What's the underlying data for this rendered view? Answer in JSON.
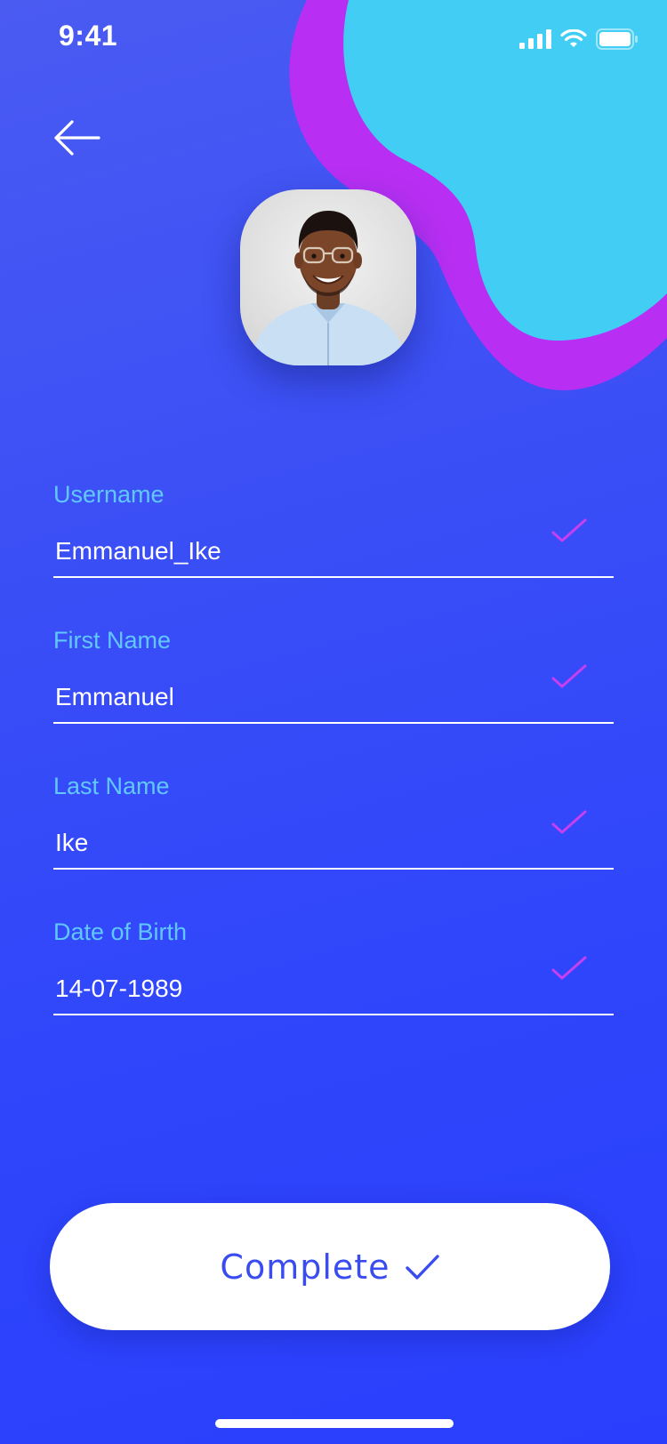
{
  "status_bar": {
    "time": "9:41",
    "signal_icon": "cellular-signal-icon",
    "wifi_icon": "wifi-icon",
    "battery_icon": "battery-icon"
  },
  "header": {
    "back_icon": "arrow-left-icon"
  },
  "avatar": {
    "icon": "profile-photo"
  },
  "form": {
    "fields": [
      {
        "label": "Username",
        "value": "Emmanuel_Ike",
        "status_icon": "checkmark-icon"
      },
      {
        "label": "First Name",
        "value": "Emmanuel",
        "status_icon": "checkmark-icon"
      },
      {
        "label": "Last Name",
        "value": "Ike",
        "status_icon": "checkmark-icon"
      },
      {
        "label": "Date of Birth",
        "value": "14-07-1989",
        "status_icon": "checkmark-icon"
      }
    ]
  },
  "complete_button": {
    "label": "Complete",
    "icon": "checkmark-icon"
  },
  "colors": {
    "background_top": "#4a5bf2",
    "background_bottom": "#2a3ffd",
    "blob_purple": "#b82ff3",
    "blob_cyan": "#41cdf4",
    "label": "#61c8ff",
    "check": "#c63ff0",
    "button_text": "#3a4cf0"
  }
}
